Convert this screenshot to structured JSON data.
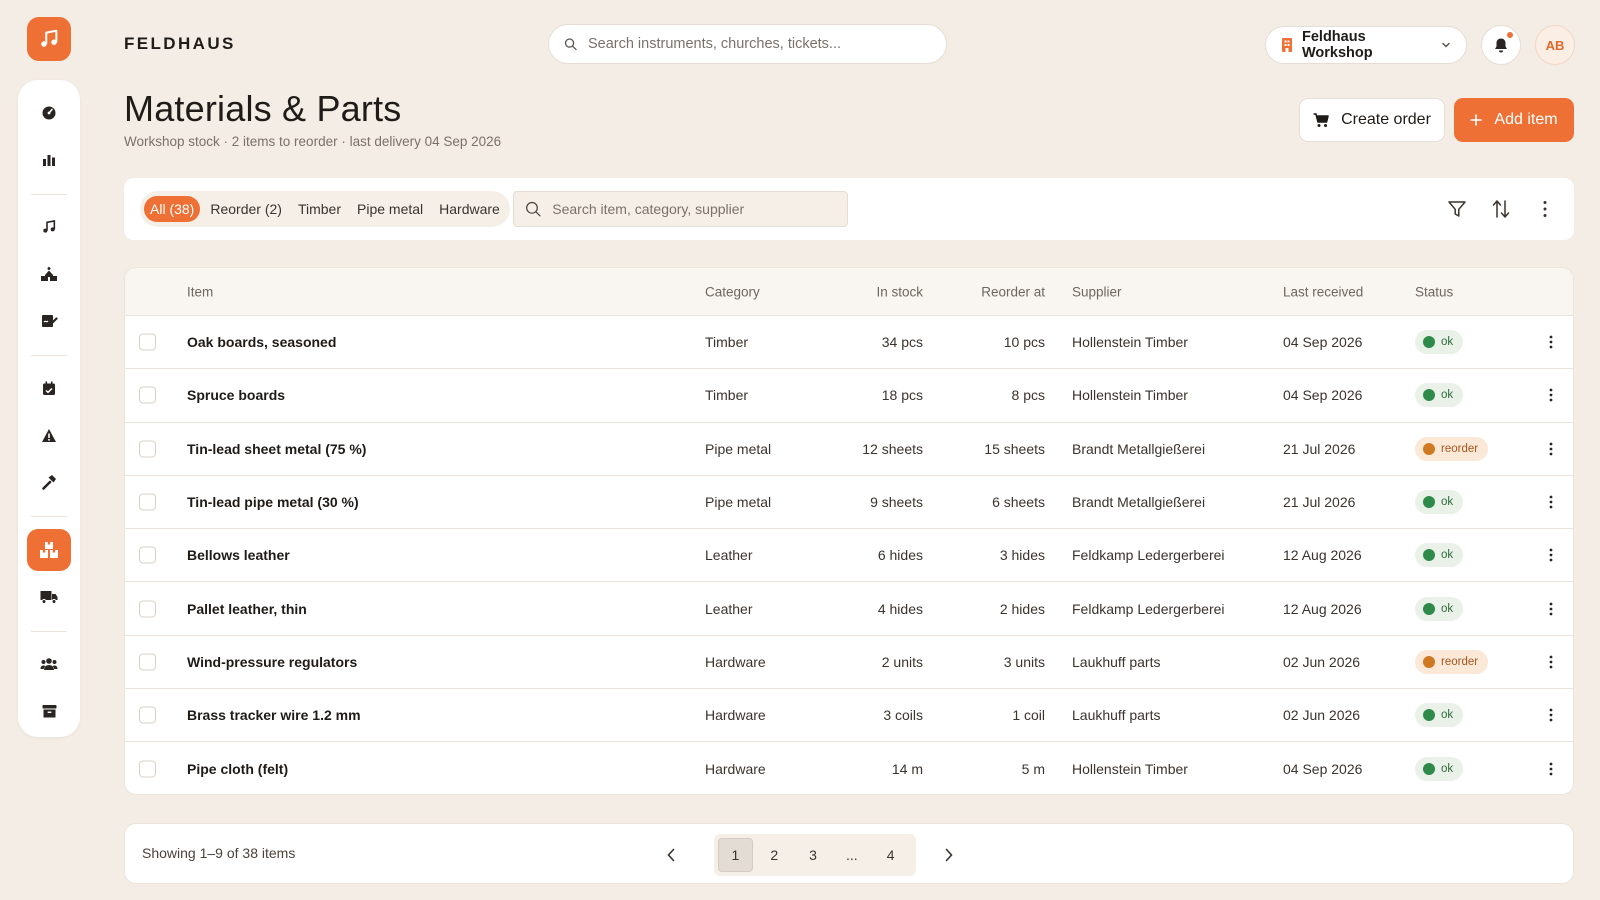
{
  "app": {
    "brand": "FELDHAUS",
    "search_placeholder": "Search instruments, churches, tickets...",
    "workspace": "Feldhaus Workshop",
    "avatar_initials": "AB",
    "accent": "#ee7034"
  },
  "sidebar": {
    "items": [
      {
        "icon": "dashboard-icon"
      },
      {
        "icon": "bar-chart-icon"
      },
      {
        "icon": "music-note-icon"
      },
      {
        "icon": "church-icon"
      },
      {
        "icon": "signature-icon"
      },
      {
        "icon": "calendar-icon"
      },
      {
        "icon": "warning-icon"
      },
      {
        "icon": "hammer-icon"
      },
      {
        "icon": "boxes-icon",
        "active": true
      },
      {
        "icon": "truck-icon"
      },
      {
        "icon": "users-icon"
      },
      {
        "icon": "archive-icon"
      }
    ]
  },
  "page": {
    "title": "Materials & Parts",
    "subtitle": "Workshop stock · 2 items to reorder · last delivery 04 Sep 2026",
    "create_order_label": "Create order",
    "add_item_label": "Add item"
  },
  "filters": {
    "chips": [
      "All (38)",
      "Reorder (2)",
      "Timber",
      "Pipe metal",
      "Hardware"
    ],
    "active_chip": 0,
    "search_placeholder": "Search item, category, supplier"
  },
  "table": {
    "headers": {
      "item": "Item",
      "category": "Category",
      "in_stock": "In stock",
      "reorder_at": "Reorder at",
      "supplier": "Supplier",
      "last_received": "Last received",
      "status": "Status"
    },
    "rows": [
      {
        "item": "Oak boards, seasoned",
        "category": "Timber",
        "in_stock": "34 pcs",
        "reorder_at": "10 pcs",
        "supplier": "Hollenstein Timber",
        "last_received": "04 Sep 2026",
        "status": "ok"
      },
      {
        "item": "Spruce boards",
        "category": "Timber",
        "in_stock": "18 pcs",
        "reorder_at": "8 pcs",
        "supplier": "Hollenstein Timber",
        "last_received": "04 Sep 2026",
        "status": "ok"
      },
      {
        "item": "Tin-lead sheet metal (75 %)",
        "category": "Pipe metal",
        "in_stock": "12 sheets",
        "reorder_at": "15 sheets",
        "supplier": "Brandt Metallgießerei",
        "last_received": "21 Jul 2026",
        "status": "reorder"
      },
      {
        "item": "Tin-lead pipe metal (30 %)",
        "category": "Pipe metal",
        "in_stock": "9 sheets",
        "reorder_at": "6 sheets",
        "supplier": "Brandt Metallgießerei",
        "last_received": "21 Jul 2026",
        "status": "ok"
      },
      {
        "item": "Bellows leather",
        "category": "Leather",
        "in_stock": "6 hides",
        "reorder_at": "3 hides",
        "supplier": "Feldkamp Ledergerberei",
        "last_received": "12 Aug 2026",
        "status": "ok"
      },
      {
        "item": "Pallet leather, thin",
        "category": "Leather",
        "in_stock": "4 hides",
        "reorder_at": "2 hides",
        "supplier": "Feldkamp Ledergerberei",
        "last_received": "12 Aug 2026",
        "status": "ok"
      },
      {
        "item": "Wind-pressure regulators",
        "category": "Hardware",
        "in_stock": "2 units",
        "reorder_at": "3 units",
        "supplier": "Laukhuff parts",
        "last_received": "02 Jun 2026",
        "status": "reorder"
      },
      {
        "item": "Brass tracker wire 1.2 mm",
        "category": "Hardware",
        "in_stock": "3 coils",
        "reorder_at": "1 coil",
        "supplier": "Laukhuff parts",
        "last_received": "02 Jun 2026",
        "status": "ok"
      },
      {
        "item": "Pipe cloth (felt)",
        "category": "Hardware",
        "in_stock": "14 m",
        "reorder_at": "5 m",
        "supplier": "Hollenstein Timber",
        "last_received": "04 Sep 2026",
        "status": "ok"
      }
    ]
  },
  "pagination": {
    "showing": "Showing 1–9 of 38 items",
    "pages": [
      "1",
      "2",
      "3",
      "...",
      "4"
    ],
    "current": "1"
  }
}
